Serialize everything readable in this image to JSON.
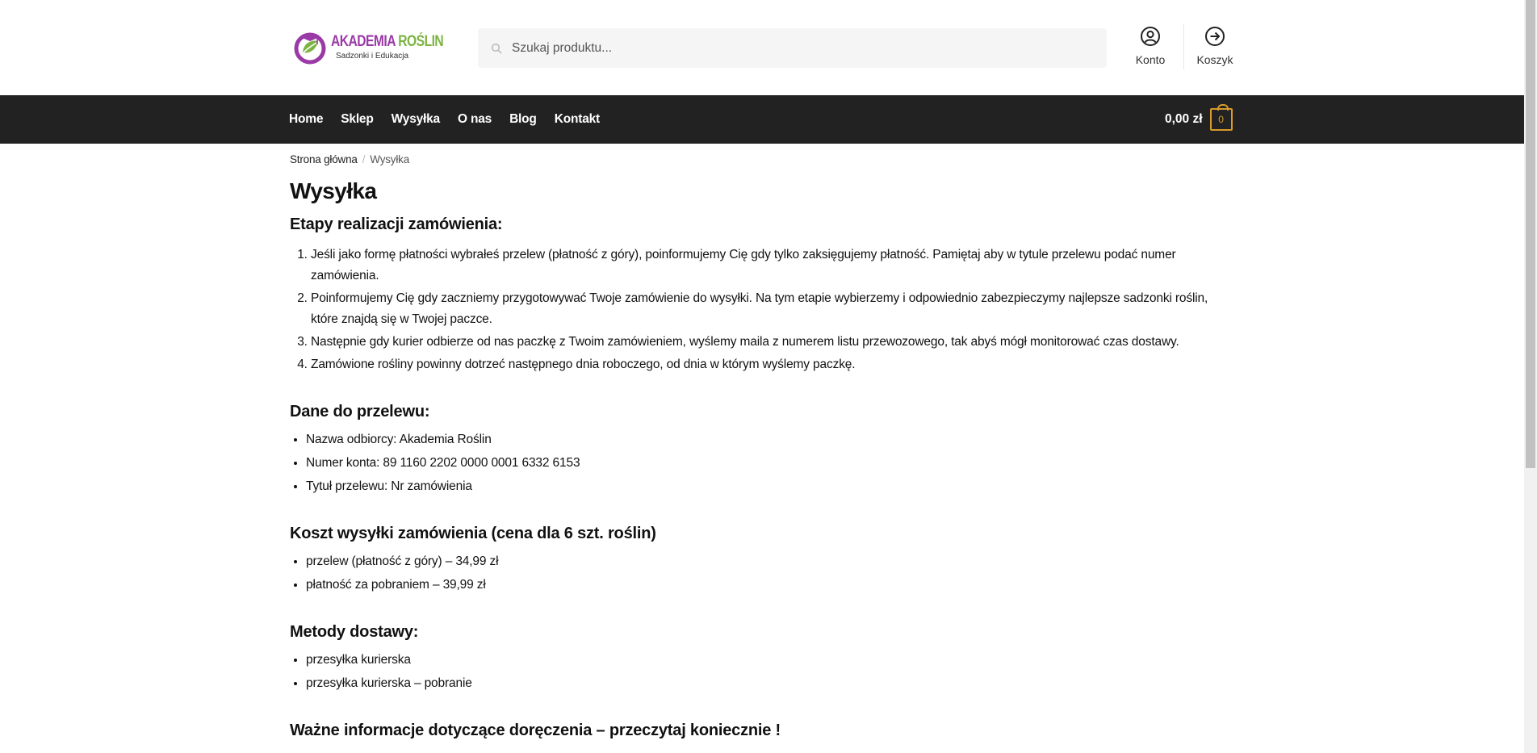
{
  "logo": {
    "title_part1": "AKADEMIA ",
    "title_part2": "ROŚLIN",
    "subtitle": "Sadzonki i Edukacja",
    "colors": {
      "purple": "#9a3aa6",
      "green": "#7cb342"
    }
  },
  "search": {
    "placeholder": "Szukaj produktu...",
    "value": ""
  },
  "header_links": {
    "account": "Konto",
    "cart": "Koszyk"
  },
  "nav": {
    "items": [
      "Home",
      "Sklep",
      "Wysyłka",
      "O nas",
      "Blog",
      "Kontakt"
    ]
  },
  "cart": {
    "total": "0,00 zł",
    "count": "0",
    "accent": "#d79a2b"
  },
  "breadcrumb": {
    "home": "Strona główna",
    "separator": "/",
    "current": "Wysyłka"
  },
  "page": {
    "title": "Wysyłka",
    "sections": [
      {
        "heading": "Etapy realizacji zamówienia:",
        "ordered": true,
        "items": [
          "Jeśli jako formę płatności wybrałeś przelew (płatność z góry), poinformujemy Cię gdy tylko zaksięgujemy płatność. Pamiętaj aby w tytule przelewu podać numer zamówienia.",
          "Poinformujemy Cię gdy zaczniemy przygotowywać Twoje zamówienie do wysyłki. Na tym etapie wybierzemy i odpowiednio zabezpieczymy najlepsze sadzonki roślin, które znajdą się w Twojej paczce.",
          "Następnie gdy kurier odbierze od nas paczkę z Twoim zamówieniem, wyślemy maila z numerem listu przewozowego, tak abyś mógł monitorować czas dostawy.",
          "Zamówione rośliny powinny dotrzeć następnego dnia roboczego, od dnia w którym wyślemy paczkę."
        ]
      },
      {
        "heading": "Dane do przelewu:",
        "ordered": false,
        "items": [
          "Nazwa odbiorcy: Akademia Roślin",
          "Numer konta: 89 1160 2202 0000 0001 6332 6153",
          "Tytuł przelewu: Nr zamówienia"
        ]
      },
      {
        "heading": "Koszt wysyłki zamówienia (cena dla 6 szt. roślin)",
        "ordered": false,
        "items": [
          "przelew (płatność z góry) – 34,99 zł",
          "płatność za pobraniem – 39,99 zł"
        ]
      },
      {
        "heading": "Metody dostawy:",
        "ordered": false,
        "items": [
          "przesyłka kurierska",
          "przesyłka kurierska – pobranie"
        ]
      },
      {
        "heading": "Ważne informacje dotyczące doręczenia – przeczytaj koniecznie !",
        "ordered": false,
        "items": []
      }
    ]
  },
  "icons": {
    "search": "search-icon",
    "account": "user-circle-icon",
    "cart": "arrow-right-circle-icon",
    "cart_badge": "cart-bag-icon"
  }
}
